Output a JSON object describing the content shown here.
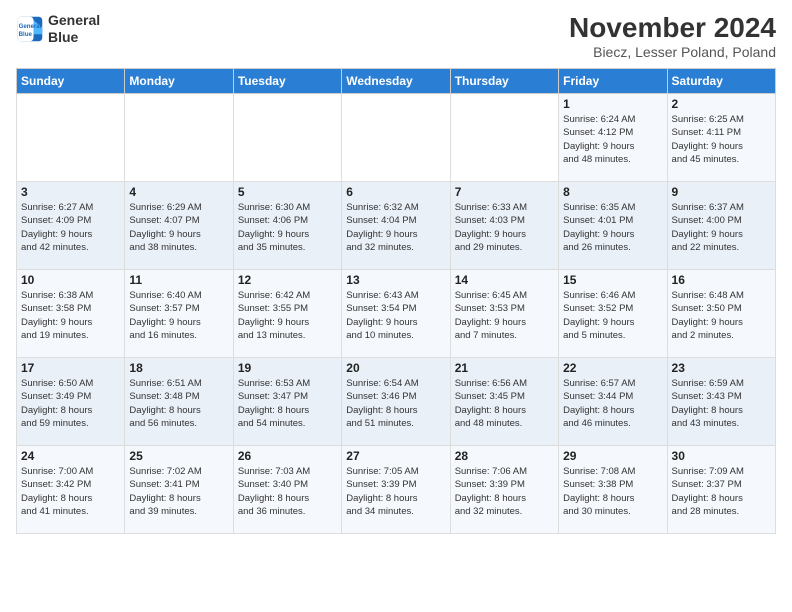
{
  "logo": {
    "line1": "General",
    "line2": "Blue"
  },
  "title": "November 2024",
  "subtitle": "Biecz, Lesser Poland, Poland",
  "weekdays": [
    "Sunday",
    "Monday",
    "Tuesday",
    "Wednesday",
    "Thursday",
    "Friday",
    "Saturday"
  ],
  "weeks": [
    [
      {
        "day": "",
        "detail": ""
      },
      {
        "day": "",
        "detail": ""
      },
      {
        "day": "",
        "detail": ""
      },
      {
        "day": "",
        "detail": ""
      },
      {
        "day": "",
        "detail": ""
      },
      {
        "day": "1",
        "detail": "Sunrise: 6:24 AM\nSunset: 4:12 PM\nDaylight: 9 hours\nand 48 minutes."
      },
      {
        "day": "2",
        "detail": "Sunrise: 6:25 AM\nSunset: 4:11 PM\nDaylight: 9 hours\nand 45 minutes."
      }
    ],
    [
      {
        "day": "3",
        "detail": "Sunrise: 6:27 AM\nSunset: 4:09 PM\nDaylight: 9 hours\nand 42 minutes."
      },
      {
        "day": "4",
        "detail": "Sunrise: 6:29 AM\nSunset: 4:07 PM\nDaylight: 9 hours\nand 38 minutes."
      },
      {
        "day": "5",
        "detail": "Sunrise: 6:30 AM\nSunset: 4:06 PM\nDaylight: 9 hours\nand 35 minutes."
      },
      {
        "day": "6",
        "detail": "Sunrise: 6:32 AM\nSunset: 4:04 PM\nDaylight: 9 hours\nand 32 minutes."
      },
      {
        "day": "7",
        "detail": "Sunrise: 6:33 AM\nSunset: 4:03 PM\nDaylight: 9 hours\nand 29 minutes."
      },
      {
        "day": "8",
        "detail": "Sunrise: 6:35 AM\nSunset: 4:01 PM\nDaylight: 9 hours\nand 26 minutes."
      },
      {
        "day": "9",
        "detail": "Sunrise: 6:37 AM\nSunset: 4:00 PM\nDaylight: 9 hours\nand 22 minutes."
      }
    ],
    [
      {
        "day": "10",
        "detail": "Sunrise: 6:38 AM\nSunset: 3:58 PM\nDaylight: 9 hours\nand 19 minutes."
      },
      {
        "day": "11",
        "detail": "Sunrise: 6:40 AM\nSunset: 3:57 PM\nDaylight: 9 hours\nand 16 minutes."
      },
      {
        "day": "12",
        "detail": "Sunrise: 6:42 AM\nSunset: 3:55 PM\nDaylight: 9 hours\nand 13 minutes."
      },
      {
        "day": "13",
        "detail": "Sunrise: 6:43 AM\nSunset: 3:54 PM\nDaylight: 9 hours\nand 10 minutes."
      },
      {
        "day": "14",
        "detail": "Sunrise: 6:45 AM\nSunset: 3:53 PM\nDaylight: 9 hours\nand 7 minutes."
      },
      {
        "day": "15",
        "detail": "Sunrise: 6:46 AM\nSunset: 3:52 PM\nDaylight: 9 hours\nand 5 minutes."
      },
      {
        "day": "16",
        "detail": "Sunrise: 6:48 AM\nSunset: 3:50 PM\nDaylight: 9 hours\nand 2 minutes."
      }
    ],
    [
      {
        "day": "17",
        "detail": "Sunrise: 6:50 AM\nSunset: 3:49 PM\nDaylight: 8 hours\nand 59 minutes."
      },
      {
        "day": "18",
        "detail": "Sunrise: 6:51 AM\nSunset: 3:48 PM\nDaylight: 8 hours\nand 56 minutes."
      },
      {
        "day": "19",
        "detail": "Sunrise: 6:53 AM\nSunset: 3:47 PM\nDaylight: 8 hours\nand 54 minutes."
      },
      {
        "day": "20",
        "detail": "Sunrise: 6:54 AM\nSunset: 3:46 PM\nDaylight: 8 hours\nand 51 minutes."
      },
      {
        "day": "21",
        "detail": "Sunrise: 6:56 AM\nSunset: 3:45 PM\nDaylight: 8 hours\nand 48 minutes."
      },
      {
        "day": "22",
        "detail": "Sunrise: 6:57 AM\nSunset: 3:44 PM\nDaylight: 8 hours\nand 46 minutes."
      },
      {
        "day": "23",
        "detail": "Sunrise: 6:59 AM\nSunset: 3:43 PM\nDaylight: 8 hours\nand 43 minutes."
      }
    ],
    [
      {
        "day": "24",
        "detail": "Sunrise: 7:00 AM\nSunset: 3:42 PM\nDaylight: 8 hours\nand 41 minutes."
      },
      {
        "day": "25",
        "detail": "Sunrise: 7:02 AM\nSunset: 3:41 PM\nDaylight: 8 hours\nand 39 minutes."
      },
      {
        "day": "26",
        "detail": "Sunrise: 7:03 AM\nSunset: 3:40 PM\nDaylight: 8 hours\nand 36 minutes."
      },
      {
        "day": "27",
        "detail": "Sunrise: 7:05 AM\nSunset: 3:39 PM\nDaylight: 8 hours\nand 34 minutes."
      },
      {
        "day": "28",
        "detail": "Sunrise: 7:06 AM\nSunset: 3:39 PM\nDaylight: 8 hours\nand 32 minutes."
      },
      {
        "day": "29",
        "detail": "Sunrise: 7:08 AM\nSunset: 3:38 PM\nDaylight: 8 hours\nand 30 minutes."
      },
      {
        "day": "30",
        "detail": "Sunrise: 7:09 AM\nSunset: 3:37 PM\nDaylight: 8 hours\nand 28 minutes."
      }
    ]
  ]
}
